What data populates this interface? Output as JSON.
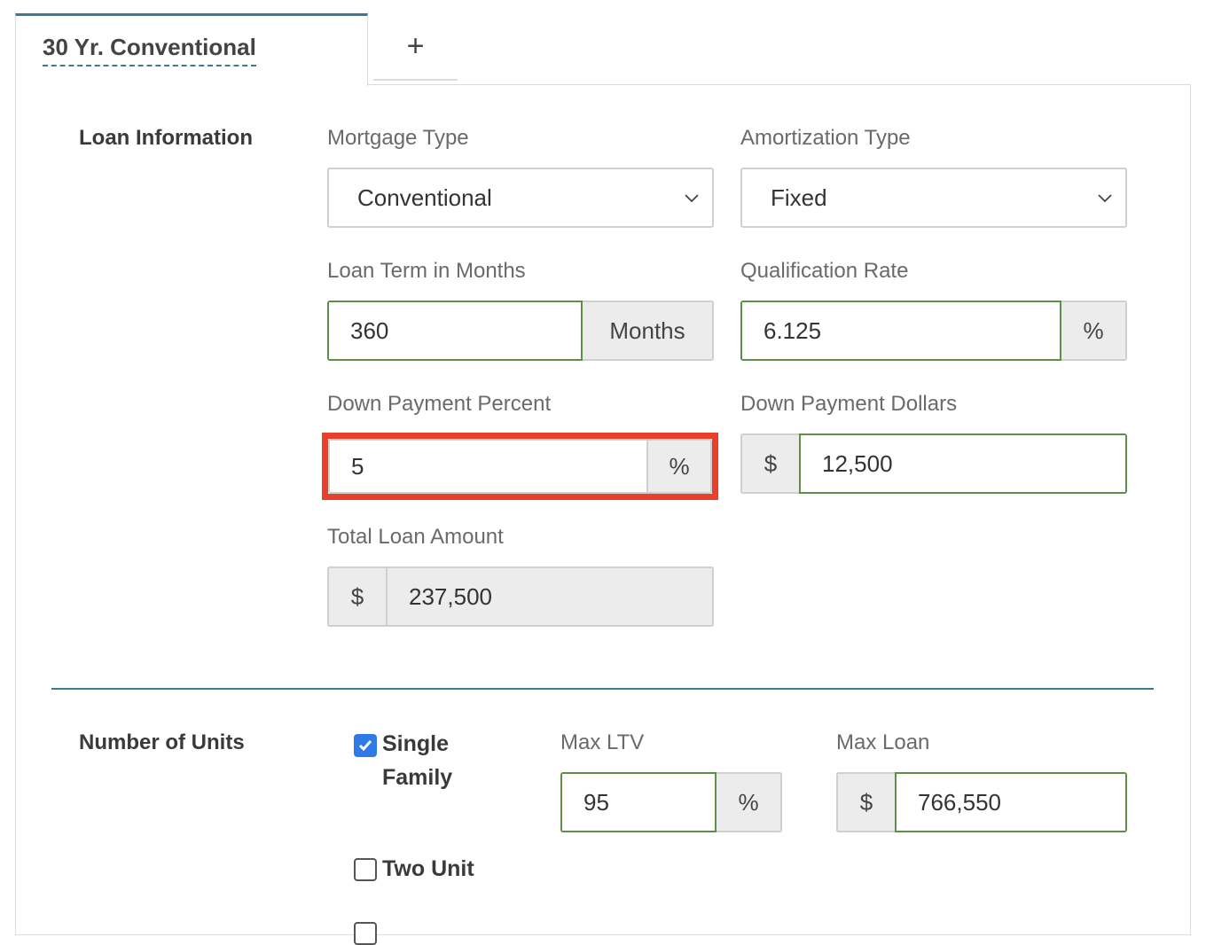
{
  "tabs": {
    "active_label": "30 Yr. Conventional",
    "add_label": "+"
  },
  "loan_information": {
    "title": "Loan Information",
    "mortgage_type": {
      "label": "Mortgage Type",
      "value": "Conventional"
    },
    "amortization_type": {
      "label": "Amortization Type",
      "value": "Fixed"
    },
    "loan_term": {
      "label": "Loan Term in Months",
      "value": "360",
      "unit": "Months"
    },
    "qualification_rate": {
      "label": "Qualification Rate",
      "value": "6.125",
      "unit": "%"
    },
    "down_payment_percent": {
      "label": "Down Payment Percent",
      "value": "5",
      "unit": "%"
    },
    "down_payment_dollars": {
      "label": "Down Payment Dollars",
      "prefix": "$",
      "value": "12,500"
    },
    "total_loan_amount": {
      "label": "Total Loan Amount",
      "prefix": "$",
      "value": "237,500"
    }
  },
  "number_of_units": {
    "title": "Number of Units",
    "options": [
      {
        "label": "Single Family",
        "checked": true
      },
      {
        "label": "Two Unit",
        "checked": false
      }
    ],
    "max_ltv": {
      "label": "Max LTV",
      "value": "95",
      "unit": "%"
    },
    "max_loan": {
      "label": "Max Loan",
      "prefix": "$",
      "value": "766,550"
    }
  },
  "colors": {
    "accent": "#3b7a93",
    "valid_border": "#5e8f47",
    "highlight": "#e8402a",
    "checkbox": "#2f7ae5"
  }
}
